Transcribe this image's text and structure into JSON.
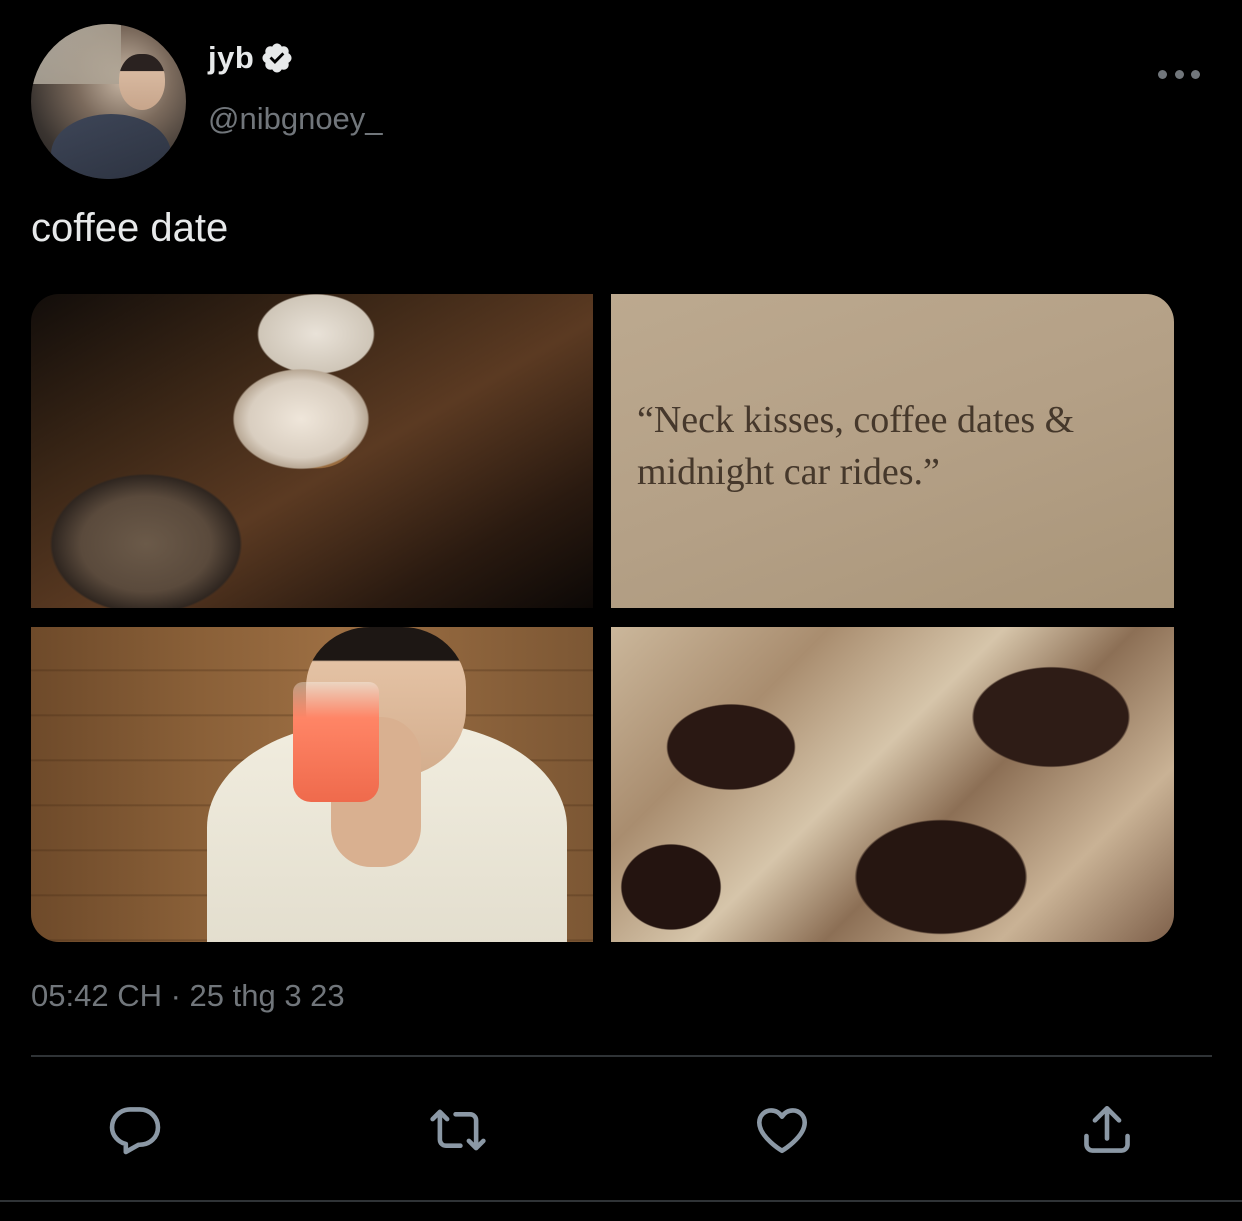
{
  "author": {
    "display_name": "jyb",
    "handle": "@nibgnoey_",
    "verified": true
  },
  "tweet": {
    "text": "coffee date",
    "media_quote": "“Neck kisses, coffee dates & midnight car rides.”",
    "timestamp": "05:42 CH · 25 thg 3 23"
  },
  "icons": {
    "verified": "verified-badge-icon",
    "more": "more-options-icon",
    "reply": "reply-icon",
    "retweet": "retweet-icon",
    "like": "heart-icon",
    "share": "share-icon"
  },
  "colors": {
    "background": "#000000",
    "text_primary": "#e7e9ea",
    "text_secondary": "#71767b",
    "divider": "#2f3336"
  }
}
